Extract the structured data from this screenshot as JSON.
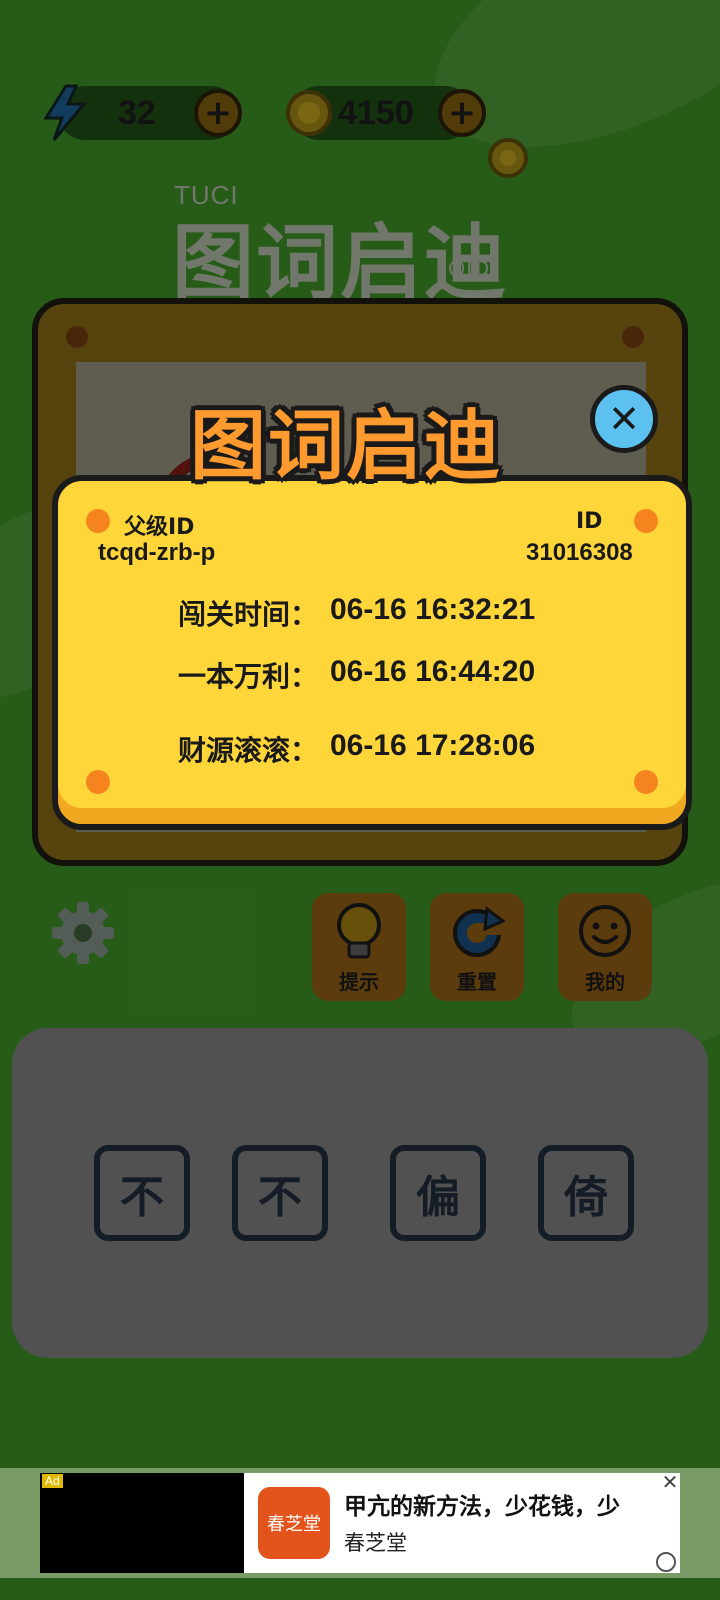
{
  "topbar": {
    "energy_value": "32",
    "coins_value": "4150"
  },
  "logo": {
    "top_text": "TUCI",
    "title": "图词启迪",
    "bottom_text": "QIDI"
  },
  "popup": {
    "title": "图词启迪",
    "parent_id_label": "父级ID",
    "parent_id_value": "tcqd-zrb-p",
    "id_label": "ID",
    "id_value": "31016308",
    "rows": [
      {
        "label": "闯关时间：",
        "value": "06-16 16:32:21"
      },
      {
        "label": "一本万利：",
        "value": "06-16 16:44:20"
      },
      {
        "label": "财源滚滚：",
        "value": "06-16 17:28:06"
      }
    ]
  },
  "actions": {
    "hint_label": "提示",
    "reset_label": "重置",
    "mine_label": "我的"
  },
  "answer_tiles": [
    "不",
    "不",
    "偏",
    "倚"
  ],
  "ad": {
    "tag": "Ad",
    "logo_text": "春芝堂",
    "headline": "甲亢的新方法，少花钱，少",
    "brand": "春芝堂"
  },
  "colors": {
    "background_green": "#3a8a24",
    "popup_yellow": "#ffd63a",
    "title_orange": "#ff9a2e",
    "close_blue": "#5cc0f0"
  }
}
